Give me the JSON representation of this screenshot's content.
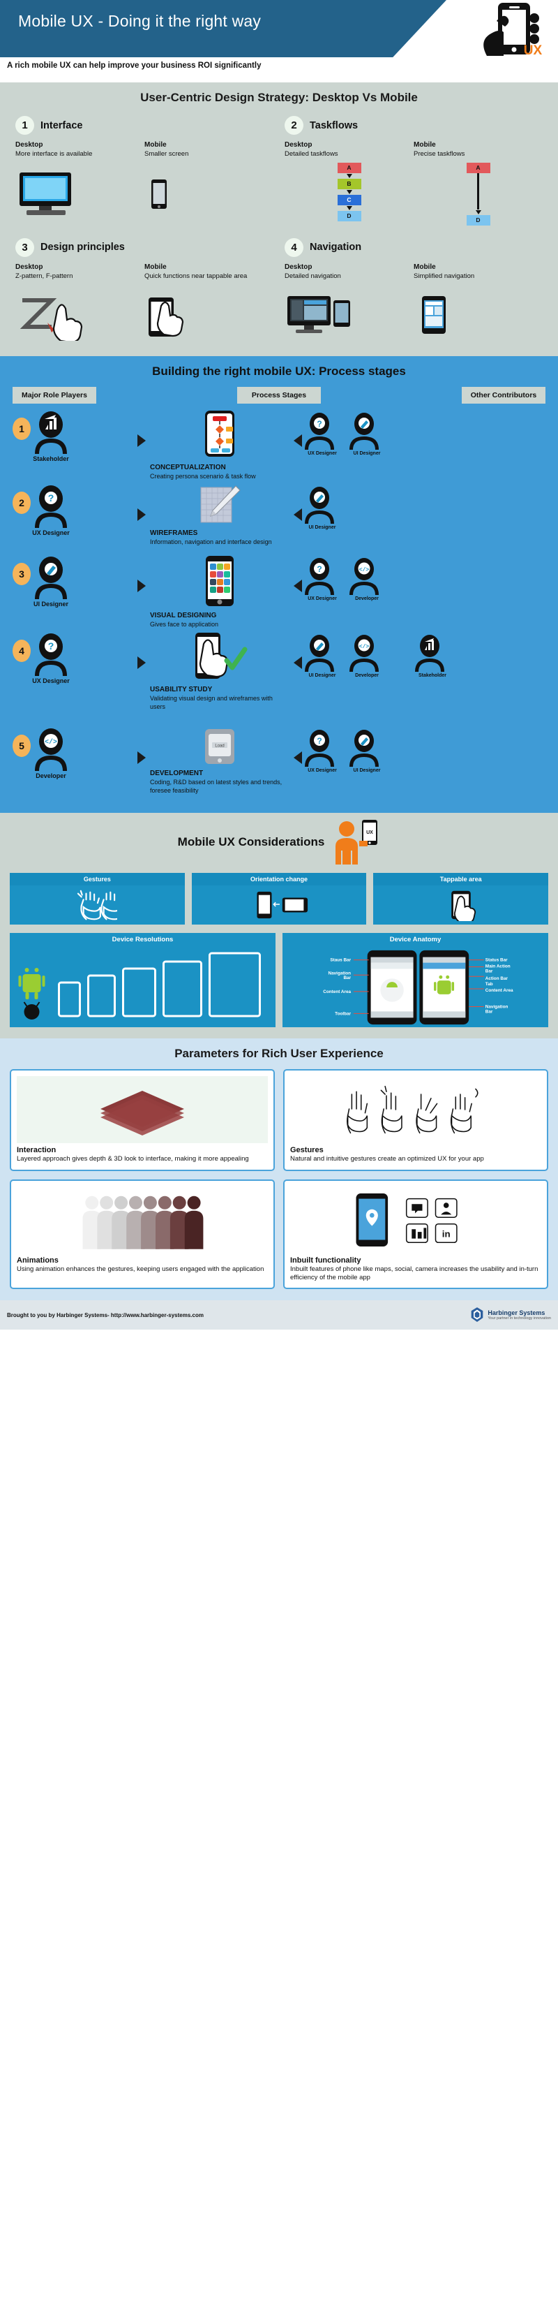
{
  "header": {
    "title": "Mobile UX - Doing it the right way",
    "subtitle": "A rich mobile UX can help improve your business ROI significantly",
    "logo_text": "UX",
    "accent_blue": "#23628a",
    "accent_orange": "#f07d1a"
  },
  "section1": {
    "title": "User-Centric Design Strategy: Desktop Vs Mobile",
    "bg": "#cbd5d0",
    "items": [
      {
        "num": "1",
        "title": "Interface",
        "desktop_label": "Desktop",
        "desktop_text": "More interface is available",
        "mobile_label": "Mobile",
        "mobile_text": "Smaller screen"
      },
      {
        "num": "2",
        "title": "Taskflows",
        "desktop_label": "Desktop",
        "desktop_text": "Detailed taskflows",
        "mobile_label": "Mobile",
        "mobile_text": "Precise taskflows",
        "desktop_flow": [
          "A",
          "B",
          "C",
          "D"
        ],
        "mobile_flow": [
          "A",
          "D"
        ]
      },
      {
        "num": "3",
        "title": "Design principles",
        "desktop_label": "Desktop",
        "desktop_text": "Z-pattern, F-pattern",
        "mobile_label": "Mobile",
        "mobile_text": "Quick functions near tappable area"
      },
      {
        "num": "4",
        "title": "Navigation",
        "desktop_label": "Desktop",
        "desktop_text": "Detailed navigation",
        "mobile_label": "Mobile",
        "mobile_text": "Simplified navigation"
      }
    ]
  },
  "section2": {
    "title": "Building the right mobile UX: Process stages",
    "bg": "#3f9bd6",
    "col_headers": [
      "Major Role Players",
      "Process Stages",
      "Other Contributors"
    ],
    "rows": [
      {
        "num": "1",
        "role": "Stakeholder",
        "role_icon": "chart-avatar-icon",
        "stage": "CONCEPTUALIZATION",
        "desc": "Creating persona scenario & task flow",
        "stage_icon": "flowchart-phone-icon",
        "contributors": [
          {
            "label": "UX Designer",
            "icon": "question-avatar-icon"
          },
          {
            "label": "UI Designer",
            "icon": "pen-avatar-icon"
          }
        ]
      },
      {
        "num": "2",
        "role": "UX Designer",
        "role_icon": "question-avatar-icon",
        "stage": "WIREFRAMES",
        "desc": "Information, navigation and interface design",
        "stage_icon": "sketchpad-pencil-icon",
        "contributors": [
          {
            "label": "UI Designer",
            "icon": "pen-avatar-icon"
          }
        ]
      },
      {
        "num": "3",
        "role": "UI Designer",
        "role_icon": "pen-avatar-icon",
        "stage": "VISUAL DESIGNING",
        "desc": "Gives face to application",
        "stage_icon": "app-grid-phone-icon",
        "contributors": [
          {
            "label": "UX Designer",
            "icon": "question-avatar-icon"
          },
          {
            "label": "Developer",
            "icon": "code-avatar-icon"
          }
        ]
      },
      {
        "num": "4",
        "role": "UX Designer",
        "role_icon": "question-avatar-icon",
        "stage": "USABILITY STUDY",
        "desc": "Validating visual design and wireframes with users",
        "stage_icon": "tap-phone-check-icon",
        "contributors": [
          {
            "label": "UI Designer",
            "icon": "pen-avatar-icon"
          },
          {
            "label": "Developer",
            "icon": "code-avatar-icon"
          },
          {
            "label": "Stakeholder",
            "icon": "chart-avatar-icon"
          }
        ]
      },
      {
        "num": "5",
        "role": "Developer",
        "role_icon": "code-avatar-icon",
        "stage": "DEVELOPMENT",
        "desc": "Coding, R&D based on latest styles and trends, foresee feasibility",
        "stage_icon": "load-device-icon",
        "contributors": [
          {
            "label": "UX Designer",
            "icon": "question-avatar-icon"
          },
          {
            "label": "UI Designer",
            "icon": "pen-avatar-icon"
          }
        ]
      }
    ]
  },
  "section3": {
    "title": "Mobile UX Considerations",
    "bg": "#cbd5d0",
    "cards": [
      {
        "title": "Gestures",
        "icon": "two-hands-gesture-icon"
      },
      {
        "title": "Orientation change",
        "icon": "phone-rotate-icon"
      },
      {
        "title": "Tappable area",
        "icon": "tap-target-phone-icon"
      }
    ],
    "wide_cards": [
      {
        "title": "Device Resolutions",
        "icon": "device-sizes-icon",
        "labels": []
      },
      {
        "title": "Device Anatomy",
        "icon": "phone-anatomy-icon",
        "labels": [
          "Staus Bar",
          "Status Bar",
          "Navigation Bar",
          "Main Action Bar",
          "Action Bar",
          "Content Area",
          "Content Area",
          "Toolbar",
          "Navigation Bar"
        ]
      }
    ]
  },
  "section4": {
    "title": "Parameters for Rich User Experience",
    "bg": "#cfe3f2",
    "cards": [
      {
        "title": "Interaction",
        "desc": "Layered approach gives depth & 3D look to interface, making it more appealing",
        "icon": "layered-planes-icon"
      },
      {
        "title": "Gestures",
        "desc": "Natural and intuitive gestures create an optimized UX for your app",
        "icon": "hand-gestures-row-icon"
      },
      {
        "title": "Animations",
        "desc": "Using animation enhances the gestures, keeping users engaged with the application",
        "icon": "animation-figures-icon"
      },
      {
        "title": "Inbuilt functionality",
        "desc": "Inbuilt features of phone like maps, social, camera increases the usability and in-turn efficiency of the mobile app",
        "icon": "phone-apps-icon"
      }
    ]
  },
  "footer": {
    "text": "Brought to you by Harbinger Systems- http://www.harbinger-systems.com",
    "brand": "Harbinger Systems",
    "tagline": "Your partner in technology innovation"
  }
}
